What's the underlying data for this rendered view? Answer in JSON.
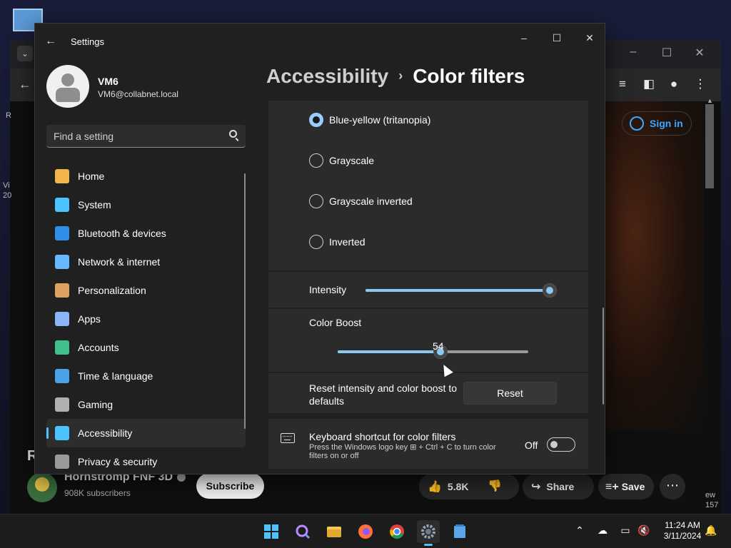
{
  "settings": {
    "title": "Settings",
    "profile": {
      "name": "VM6",
      "email": "VM6@collabnet.local"
    },
    "search_placeholder": "Find a setting",
    "nav": [
      {
        "label": "Home",
        "icon": "home-icon",
        "color": "#f3b54a"
      },
      {
        "label": "System",
        "icon": "system-icon",
        "color": "#4cc2ff"
      },
      {
        "label": "Bluetooth & devices",
        "icon": "bluetooth-icon",
        "color": "#2f8fe8"
      },
      {
        "label": "Network & internet",
        "icon": "wifi-icon",
        "color": "#66b8ff"
      },
      {
        "label": "Personalization",
        "icon": "brush-icon",
        "color": "#e0a060"
      },
      {
        "label": "Apps",
        "icon": "apps-icon",
        "color": "#8ab4f8"
      },
      {
        "label": "Accounts",
        "icon": "accounts-icon",
        "color": "#3fbf8a"
      },
      {
        "label": "Time & language",
        "icon": "globe-icon",
        "color": "#4aa3e8"
      },
      {
        "label": "Gaming",
        "icon": "gamepad-icon",
        "color": "#b0b0b0"
      },
      {
        "label": "Accessibility",
        "icon": "accessibility-icon",
        "color": "#4cc2ff"
      },
      {
        "label": "Privacy & security",
        "icon": "shield-icon",
        "color": "#9a9a9a"
      }
    ],
    "active_nav": "Accessibility",
    "breadcrumb": {
      "parent": "Accessibility",
      "separator": "›",
      "current": "Color filters"
    },
    "filters": [
      {
        "label": "Blue-yellow (tritanopia)",
        "checked": true
      },
      {
        "label": "Grayscale",
        "checked": false
      },
      {
        "label": "Grayscale inverted",
        "checked": false
      },
      {
        "label": "Inverted",
        "checked": false
      }
    ],
    "intensity": {
      "label": "Intensity",
      "value_fraction": 1.0
    },
    "color_boost": {
      "label": "Color Boost",
      "value": "54",
      "value_fraction": 0.54
    },
    "reset": {
      "label": "Reset intensity and color boost to defaults",
      "button": "Reset"
    },
    "keyboard_shortcut": {
      "title": "Keyboard shortcut for color filters",
      "description": "Press the Windows logo key ⊞ + Ctrl + C to turn color filters on or off",
      "state": "Off"
    }
  },
  "browser": {
    "sign_in": "Sign in",
    "section_heading": "R",
    "side_fragments": [
      "R",
      "Vi",
      "20",
      "ew",
      "157"
    ],
    "channel": {
      "name": "Hornstromp FNF 3D",
      "subscribers": "908K subscribers"
    },
    "subscribe": "Subscribe",
    "likes": "5.8K",
    "share": "Share",
    "save": "Save"
  },
  "taskbar": {
    "apps": [
      "start-icon",
      "search-icon",
      "file-explorer-icon",
      "firefox-icon",
      "chrome-icon",
      "settings-app-icon",
      "notepad-icon"
    ],
    "active_app": "settings-app-icon",
    "clock": {
      "time": "11:24 AM",
      "date": "3/11/2024"
    }
  }
}
